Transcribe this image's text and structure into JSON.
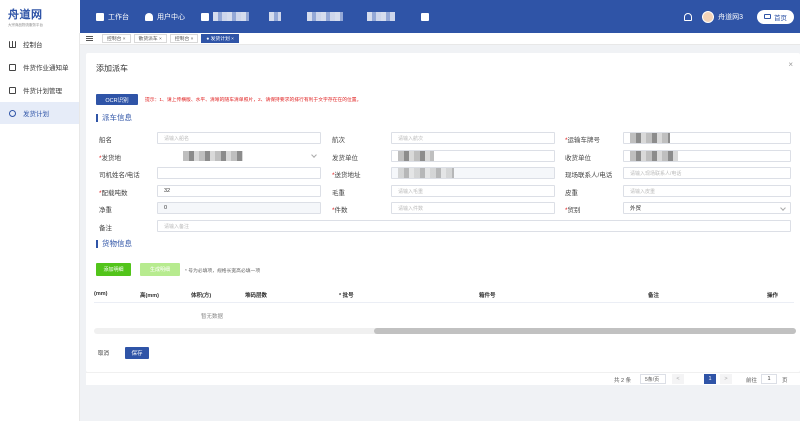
{
  "app": {
    "logo_text": "舟道网",
    "logo_sub": "大宗商品物流服务平台",
    "nav": [
      {
        "label": "工作台",
        "icon": "desktop-icon"
      },
      {
        "label": "用户中心",
        "icon": "user-icon"
      }
    ],
    "user_name": "舟道网3",
    "home_label": "首页"
  },
  "sidebar": {
    "items": [
      {
        "label": "控制台",
        "icon": "bar-chart-icon"
      },
      {
        "label": "件货作业通知单",
        "icon": "document-icon"
      },
      {
        "label": "件货计划管理",
        "icon": "clipboard-icon"
      },
      {
        "label": "发货计划",
        "icon": "globe-icon"
      }
    ]
  },
  "tags": [
    {
      "label": "控制台 ×"
    },
    {
      "label": "散货派车 ×"
    },
    {
      "label": "控制台 ×"
    },
    {
      "label": "● 发货计划 ×"
    }
  ],
  "dialog": {
    "title": "添加派车",
    "close": "×",
    "ocr_label": "OCR识别",
    "tip": "提示：1、请上传横版、水平、清晰的随车清单照片，2、请保持要求的排行有利于文字存在在的位置。",
    "section_dispatch": "派车信息",
    "section_goods": "货物信息",
    "form": {
      "ship_name": {
        "label": "船名",
        "placeholder": "请输入船名"
      },
      "voyage": {
        "label": "航次",
        "placeholder": "请输入航次"
      },
      "plate": {
        "label": "运输车牌号"
      },
      "origin": {
        "label": "发货地"
      },
      "sender": {
        "label": "发货单位"
      },
      "receiver": {
        "label": "收货单位"
      },
      "driver": {
        "label": "司机姓名/电话"
      },
      "address": {
        "label": "送货地址"
      },
      "site_contact": {
        "label": "现场联系人/电话",
        "placeholder": "请输入现场联系人/电话"
      },
      "tons": {
        "label": "配载吨数",
        "value": "32"
      },
      "gross": {
        "label": "毛重",
        "placeholder": "请输入毛重"
      },
      "tare": {
        "label": "皮重",
        "placeholder": "请输入皮重"
      },
      "net": {
        "label": "净重",
        "value": "0"
      },
      "pieces": {
        "label": "件数",
        "placeholder": "请输入件数"
      },
      "trade_type": {
        "label": "贸别",
        "value": "外贸"
      },
      "remark": {
        "label": "备注",
        "placeholder": "请输入备注"
      }
    },
    "add_detail": "添加明细",
    "gen_detail": "生成明细",
    "goods_tip": "* 号为必填项，规格长宽高必填一项",
    "table": {
      "columns": [
        "(mm)",
        "高(mm)",
        "体积(方)",
        "堆码层数",
        "* 批号",
        "箱件号",
        "备注",
        "操作"
      ],
      "empty": "暂无数据"
    },
    "cancel": "取消",
    "save": "保存"
  },
  "pager": {
    "total": "共 2 条",
    "page_size": "5条/页",
    "prev": "<",
    "current": "1",
    "next": ">",
    "goto": "前往",
    "goto_value": "1",
    "page_unit": "页"
  }
}
